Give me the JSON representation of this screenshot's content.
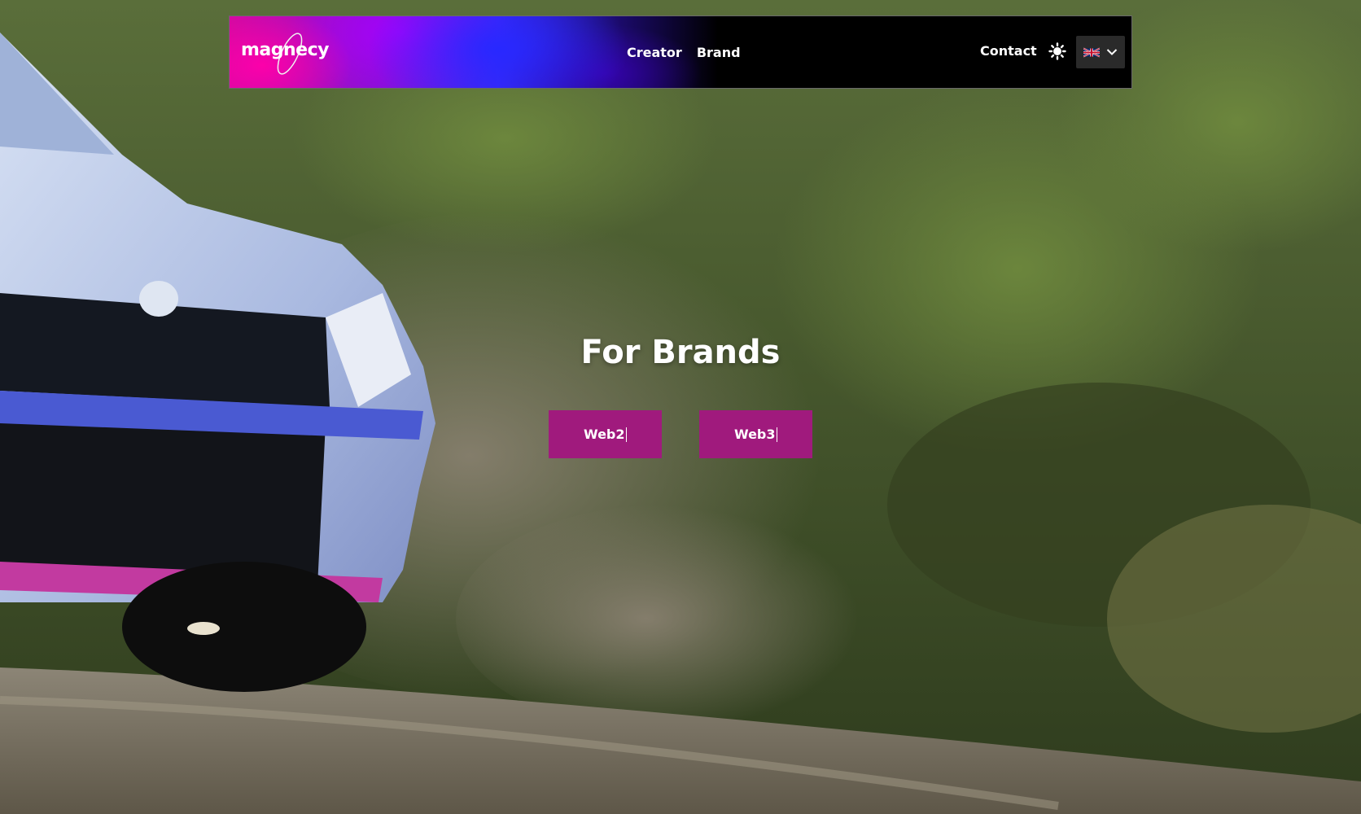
{
  "brand": {
    "logo_text": "magnecy"
  },
  "nav": {
    "items": [
      {
        "label": "Creator"
      },
      {
        "label": "Brand"
      }
    ],
    "contact_label": "Contact",
    "language": {
      "selected": "English (UK)"
    }
  },
  "hero": {
    "title": "For Brands",
    "buttons": [
      {
        "label": "Web2"
      },
      {
        "label": "Web3"
      }
    ]
  },
  "icons": {
    "theme_toggle": "sun-icon",
    "language_flag": "uk-flag-icon",
    "dropdown": "chevron-down-icon"
  },
  "colors": {
    "button_bg": "#a01a7d",
    "header_bg": "#000000",
    "text": "#ffffff"
  }
}
